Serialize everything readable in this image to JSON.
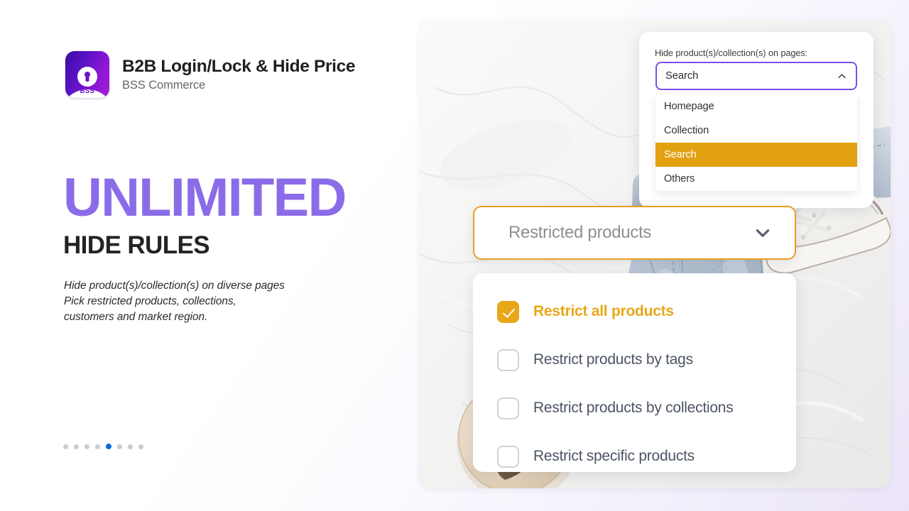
{
  "brand": {
    "title": "B2B Login/Lock & Hide Price",
    "subtitle": "BSS Commerce",
    "logo_wordmark": "BSS",
    "logo_icon": "keyhole-lock-icon",
    "logo_gradient_from": "#3a0ca3",
    "logo_gradient_to": "#a71fd6"
  },
  "headline": {
    "main": "UNLIMITED",
    "sub": "HIDE RULES",
    "main_color": "#8b6ce8",
    "sub_color": "#232326"
  },
  "body_copy": {
    "line1": "Hide product(s)/collection(s) on diverse pages",
    "line2": "Pick restricted products, collections,",
    "line3": "customers and market region."
  },
  "pagination": {
    "total": 8,
    "active_index": 4,
    "active_color": "#0b6bdb",
    "inactive_color": "#c9cbd0"
  },
  "pages_card": {
    "label": "Hide product(s)/collection(s) on pages:",
    "select_value": "Search",
    "select_border_color": "#7c4ded",
    "caret_icon": "chevron-up-icon",
    "options": [
      {
        "label": "Homepage",
        "selected": false
      },
      {
        "label": "Collection",
        "selected": false
      },
      {
        "label": "Search",
        "selected": true
      },
      {
        "label": "Others",
        "selected": false
      }
    ],
    "highlight_color": "#e2a110"
  },
  "restricted_select": {
    "value": "Restricted products",
    "caret_icon": "chevron-down-icon",
    "border_color": "#e8a020"
  },
  "rules_card": {
    "accent_color": "#e8a718",
    "rules": [
      {
        "label": "Restrict all products",
        "checked": true
      },
      {
        "label": "Restrict products by tags",
        "checked": false
      },
      {
        "label": "Restrict products by collections",
        "checked": false
      },
      {
        "label": "Restrict specific products",
        "checked": false
      }
    ]
  }
}
